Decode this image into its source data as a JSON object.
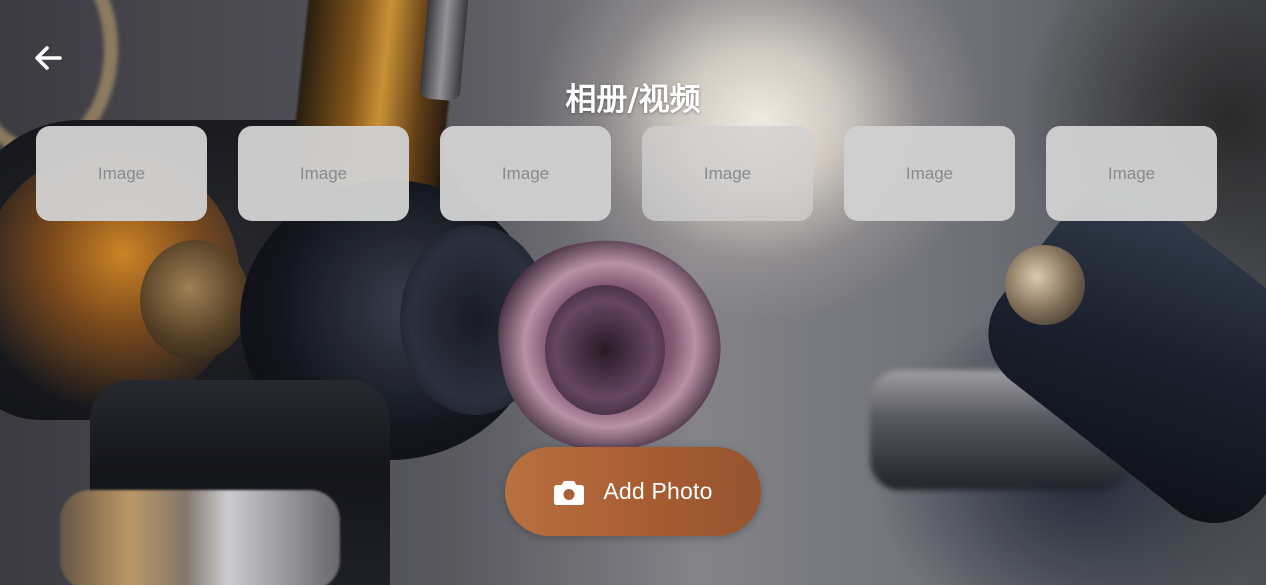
{
  "header": {
    "back_icon": "arrow-left-icon",
    "title": "相册/视频"
  },
  "gallery": {
    "thumbnails": [
      {
        "label": "Image"
      },
      {
        "label": "Image"
      },
      {
        "label": "Image"
      },
      {
        "label": "Image"
      },
      {
        "label": "Image"
      },
      {
        "label": "Image"
      }
    ]
  },
  "actions": {
    "add_photo_icon": "camera-icon",
    "add_photo_label": "Add Photo"
  },
  "colors": {
    "accent": "#a8603a",
    "thumbnail_bg": "#d0d0d0",
    "title_text": "#ffffff"
  }
}
